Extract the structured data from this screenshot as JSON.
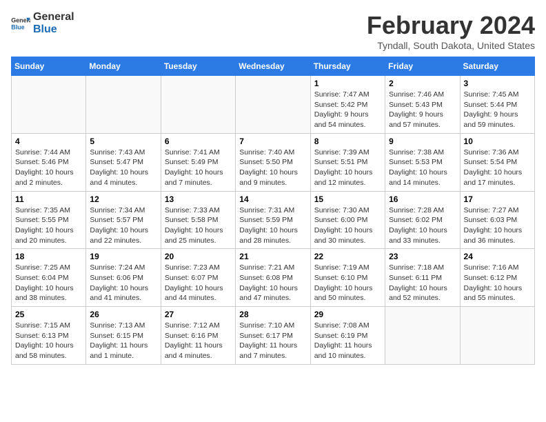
{
  "logo": {
    "text_general": "General",
    "text_blue": "Blue"
  },
  "header": {
    "main_title": "February 2024",
    "sub_title": "Tyndall, South Dakota, United States"
  },
  "days_of_week": [
    "Sunday",
    "Monday",
    "Tuesday",
    "Wednesday",
    "Thursday",
    "Friday",
    "Saturday"
  ],
  "weeks": [
    [
      {
        "day": "",
        "sunrise": "",
        "sunset": "",
        "daylight": ""
      },
      {
        "day": "",
        "sunrise": "",
        "sunset": "",
        "daylight": ""
      },
      {
        "day": "",
        "sunrise": "",
        "sunset": "",
        "daylight": ""
      },
      {
        "day": "",
        "sunrise": "",
        "sunset": "",
        "daylight": ""
      },
      {
        "day": "1",
        "sunrise": "Sunrise: 7:47 AM",
        "sunset": "Sunset: 5:42 PM",
        "daylight": "Daylight: 9 hours and 54 minutes."
      },
      {
        "day": "2",
        "sunrise": "Sunrise: 7:46 AM",
        "sunset": "Sunset: 5:43 PM",
        "daylight": "Daylight: 9 hours and 57 minutes."
      },
      {
        "day": "3",
        "sunrise": "Sunrise: 7:45 AM",
        "sunset": "Sunset: 5:44 PM",
        "daylight": "Daylight: 9 hours and 59 minutes."
      }
    ],
    [
      {
        "day": "4",
        "sunrise": "Sunrise: 7:44 AM",
        "sunset": "Sunset: 5:46 PM",
        "daylight": "Daylight: 10 hours and 2 minutes."
      },
      {
        "day": "5",
        "sunrise": "Sunrise: 7:43 AM",
        "sunset": "Sunset: 5:47 PM",
        "daylight": "Daylight: 10 hours and 4 minutes."
      },
      {
        "day": "6",
        "sunrise": "Sunrise: 7:41 AM",
        "sunset": "Sunset: 5:49 PM",
        "daylight": "Daylight: 10 hours and 7 minutes."
      },
      {
        "day": "7",
        "sunrise": "Sunrise: 7:40 AM",
        "sunset": "Sunset: 5:50 PM",
        "daylight": "Daylight: 10 hours and 9 minutes."
      },
      {
        "day": "8",
        "sunrise": "Sunrise: 7:39 AM",
        "sunset": "Sunset: 5:51 PM",
        "daylight": "Daylight: 10 hours and 12 minutes."
      },
      {
        "day": "9",
        "sunrise": "Sunrise: 7:38 AM",
        "sunset": "Sunset: 5:53 PM",
        "daylight": "Daylight: 10 hours and 14 minutes."
      },
      {
        "day": "10",
        "sunrise": "Sunrise: 7:36 AM",
        "sunset": "Sunset: 5:54 PM",
        "daylight": "Daylight: 10 hours and 17 minutes."
      }
    ],
    [
      {
        "day": "11",
        "sunrise": "Sunrise: 7:35 AM",
        "sunset": "Sunset: 5:55 PM",
        "daylight": "Daylight: 10 hours and 20 minutes."
      },
      {
        "day": "12",
        "sunrise": "Sunrise: 7:34 AM",
        "sunset": "Sunset: 5:57 PM",
        "daylight": "Daylight: 10 hours and 22 minutes."
      },
      {
        "day": "13",
        "sunrise": "Sunrise: 7:33 AM",
        "sunset": "Sunset: 5:58 PM",
        "daylight": "Daylight: 10 hours and 25 minutes."
      },
      {
        "day": "14",
        "sunrise": "Sunrise: 7:31 AM",
        "sunset": "Sunset: 5:59 PM",
        "daylight": "Daylight: 10 hours and 28 minutes."
      },
      {
        "day": "15",
        "sunrise": "Sunrise: 7:30 AM",
        "sunset": "Sunset: 6:00 PM",
        "daylight": "Daylight: 10 hours and 30 minutes."
      },
      {
        "day": "16",
        "sunrise": "Sunrise: 7:28 AM",
        "sunset": "Sunset: 6:02 PM",
        "daylight": "Daylight: 10 hours and 33 minutes."
      },
      {
        "day": "17",
        "sunrise": "Sunrise: 7:27 AM",
        "sunset": "Sunset: 6:03 PM",
        "daylight": "Daylight: 10 hours and 36 minutes."
      }
    ],
    [
      {
        "day": "18",
        "sunrise": "Sunrise: 7:25 AM",
        "sunset": "Sunset: 6:04 PM",
        "daylight": "Daylight: 10 hours and 38 minutes."
      },
      {
        "day": "19",
        "sunrise": "Sunrise: 7:24 AM",
        "sunset": "Sunset: 6:06 PM",
        "daylight": "Daylight: 10 hours and 41 minutes."
      },
      {
        "day": "20",
        "sunrise": "Sunrise: 7:23 AM",
        "sunset": "Sunset: 6:07 PM",
        "daylight": "Daylight: 10 hours and 44 minutes."
      },
      {
        "day": "21",
        "sunrise": "Sunrise: 7:21 AM",
        "sunset": "Sunset: 6:08 PM",
        "daylight": "Daylight: 10 hours and 47 minutes."
      },
      {
        "day": "22",
        "sunrise": "Sunrise: 7:19 AM",
        "sunset": "Sunset: 6:10 PM",
        "daylight": "Daylight: 10 hours and 50 minutes."
      },
      {
        "day": "23",
        "sunrise": "Sunrise: 7:18 AM",
        "sunset": "Sunset: 6:11 PM",
        "daylight": "Daylight: 10 hours and 52 minutes."
      },
      {
        "day": "24",
        "sunrise": "Sunrise: 7:16 AM",
        "sunset": "Sunset: 6:12 PM",
        "daylight": "Daylight: 10 hours and 55 minutes."
      }
    ],
    [
      {
        "day": "25",
        "sunrise": "Sunrise: 7:15 AM",
        "sunset": "Sunset: 6:13 PM",
        "daylight": "Daylight: 10 hours and 58 minutes."
      },
      {
        "day": "26",
        "sunrise": "Sunrise: 7:13 AM",
        "sunset": "Sunset: 6:15 PM",
        "daylight": "Daylight: 11 hours and 1 minute."
      },
      {
        "day": "27",
        "sunrise": "Sunrise: 7:12 AM",
        "sunset": "Sunset: 6:16 PM",
        "daylight": "Daylight: 11 hours and 4 minutes."
      },
      {
        "day": "28",
        "sunrise": "Sunrise: 7:10 AM",
        "sunset": "Sunset: 6:17 PM",
        "daylight": "Daylight: 11 hours and 7 minutes."
      },
      {
        "day": "29",
        "sunrise": "Sunrise: 7:08 AM",
        "sunset": "Sunset: 6:19 PM",
        "daylight": "Daylight: 11 hours and 10 minutes."
      },
      {
        "day": "",
        "sunrise": "",
        "sunset": "",
        "daylight": ""
      },
      {
        "day": "",
        "sunrise": "",
        "sunset": "",
        "daylight": ""
      }
    ]
  ]
}
